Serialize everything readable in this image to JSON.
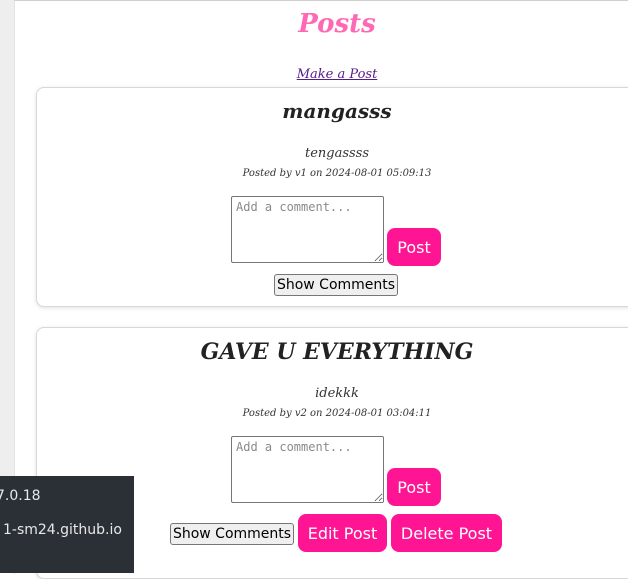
{
  "page": {
    "title": "Posts",
    "make_post_link": "Make a Post"
  },
  "posts": [
    {
      "title": "mangasss",
      "body": "tengassss",
      "meta": "Posted by v1 on 2024-08-01 05:09:13",
      "comment_placeholder": "Add a comment...",
      "post_button": "Post",
      "show_comments_button": "Show Comments"
    },
    {
      "title": "GAVE U EVERYTHING",
      "body": "idekkk",
      "meta": "Posted by v2 on 2024-08-01 03:04:11",
      "comment_placeholder": "Add a comment...",
      "post_button": "Post",
      "show_comments_button": "Show Comments",
      "edit_button": "Edit Post",
      "delete_button": "Delete Post"
    }
  ],
  "overlay": {
    "line1": "7.0.18",
    "line2": "1-sm24.github.io"
  },
  "colors": {
    "title_pink": "#ff69b4",
    "button_pink": "#ff1493",
    "overlay_bg": "#2b2f36"
  }
}
